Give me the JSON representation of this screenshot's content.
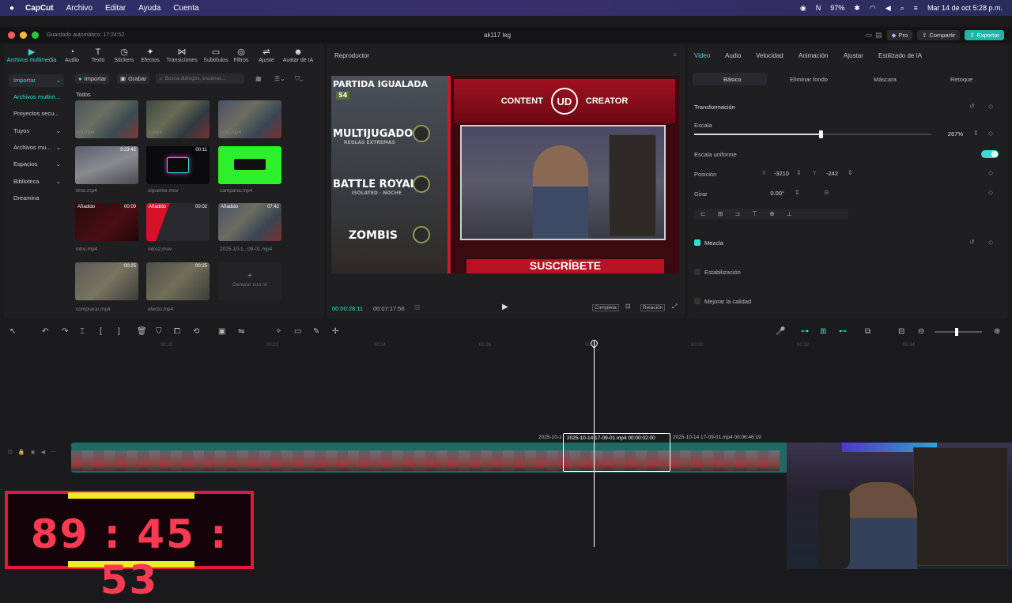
{
  "menubar": {
    "app": "CapCut",
    "items": [
      "Archivo",
      "Editar",
      "Ayuda",
      "Cuenta"
    ],
    "battery": "97%",
    "datetime": "Mar 14 de oct  5:28 p.m."
  },
  "titlebar": {
    "autosave": "Guardado automático: 17:24:52",
    "project": "ak117 leg",
    "pro": "Pro",
    "share": "Compartir",
    "export": "Exportar"
  },
  "toolbar": {
    "items": [
      {
        "label": "Archivos multimedia",
        "icon": "media-icon"
      },
      {
        "label": "Audio",
        "icon": "audio-icon"
      },
      {
        "label": "Texto",
        "icon": "text-icon"
      },
      {
        "label": "Stickers",
        "icon": "stickers-icon"
      },
      {
        "label": "Efectos",
        "icon": "effects-icon"
      },
      {
        "label": "Transiciones",
        "icon": "transitions-icon"
      },
      {
        "label": "Subtítulos",
        "icon": "subtitles-icon"
      },
      {
        "label": "Filtros",
        "icon": "filters-icon"
      },
      {
        "label": "Ajuste",
        "icon": "adjust-icon"
      },
      {
        "label": "Avatar de IA",
        "icon": "ai-avatar-icon"
      }
    ]
  },
  "sidebar": {
    "items": [
      "Importar",
      "Archivos multim...",
      "Proyectos secu...",
      "Tuyos",
      "Archivos mu...",
      "Espacios",
      "Biblioteca",
      "Dreamina"
    ]
  },
  "media": {
    "import": "Importar",
    "record": "Grabar",
    "search_placeholder": "Busca diálogos, escenas...",
    "all": "Todos",
    "generate": "Generar con IA",
    "files": [
      {
        "name": "mn.mp4",
        "badge": "",
        "dur": ""
      },
      {
        "name": "1.mp4",
        "badge": "",
        "dur": ""
      },
      {
        "name": "mn1.mp4",
        "badge": "",
        "dur": ""
      },
      {
        "name": "tiros.mp4",
        "badge": "",
        "dur": "3:23:42"
      },
      {
        "name": "sigueme.mov",
        "badge": "",
        "dur": "00:11"
      },
      {
        "name": "campana.mp4",
        "badge": "",
        "dur": ""
      },
      {
        "name": "intro.mp4",
        "badge": "Añadido",
        "dur": "00:09"
      },
      {
        "name": "intro2.mov",
        "badge": "Añadido",
        "dur": "00:02"
      },
      {
        "name": "2025-10-1...09-01.mp4",
        "badge": "Añadido",
        "dur": "07:42"
      },
      {
        "name": "comprarar.mp4",
        "badge": "",
        "dur": "00:25"
      },
      {
        "name": "efecto.mp4",
        "badge": "",
        "dur": "00:25"
      }
    ]
  },
  "player": {
    "title": "Reproductor",
    "current": "00:00:28:11",
    "total": "00:07:17:56",
    "complete": "Completa",
    "ratio": "Relación",
    "menu": [
      {
        "label": "PARTIDA IGUALADA",
        "sub": "",
        "tag": "S4"
      },
      {
        "label": "MULTIJUGADOR",
        "sub": "REGLAS EXTREMAS",
        "tag": ""
      },
      {
        "label": "BATTLE ROYALE",
        "sub": "ISOLATED · NOCHE",
        "tag": ""
      },
      {
        "label": "ZOMBIS",
        "sub": "",
        "tag": ""
      }
    ],
    "banner_left": "CONTENT",
    "banner_right": "CREATOR",
    "banner_logo": "UD",
    "bottom_text": "SUSCRÍBETE"
  },
  "inspector": {
    "tabs": [
      "Video",
      "Audio",
      "Velocidad",
      "Animación",
      "Ajustar",
      "Estilizado de IA"
    ],
    "subtabs": [
      "Básico",
      "Eliminar fondo",
      "Máscara",
      "Retoque"
    ],
    "transform": "Transformación",
    "scale": "Escala",
    "scale_value": "267%",
    "uniform": "Escala uniforme",
    "position": "Posición",
    "pos_x_label": "X",
    "pos_x": "-3210",
    "pos_y_label": "Y",
    "pos_y": "-242",
    "rotate": "Girar",
    "rotate_value": "0.00°",
    "blend": "Mezcla",
    "stabilize": "Estabilización",
    "enhance": "Mejorar la calidad"
  },
  "timeline": {
    "ruler": [
      "00:20",
      "00:22",
      "00:24",
      "00:26",
      "00:28",
      "00:30",
      "00:32",
      "00:34"
    ],
    "clip_before": "2025-10-1",
    "clip_selected": "2025-10-14 17-09-01.mp4  00:00:02:00",
    "clip_after": "2025-10-14 17-09-01.mp4  00:06:46:19"
  },
  "overlay": {
    "timer": "89 : 45 : 53"
  },
  "colors": {
    "accent": "#3fd8d2",
    "export": "#1fb5a8",
    "timer_red": "#e3193b",
    "timer_yellow": "#f3e92c"
  }
}
